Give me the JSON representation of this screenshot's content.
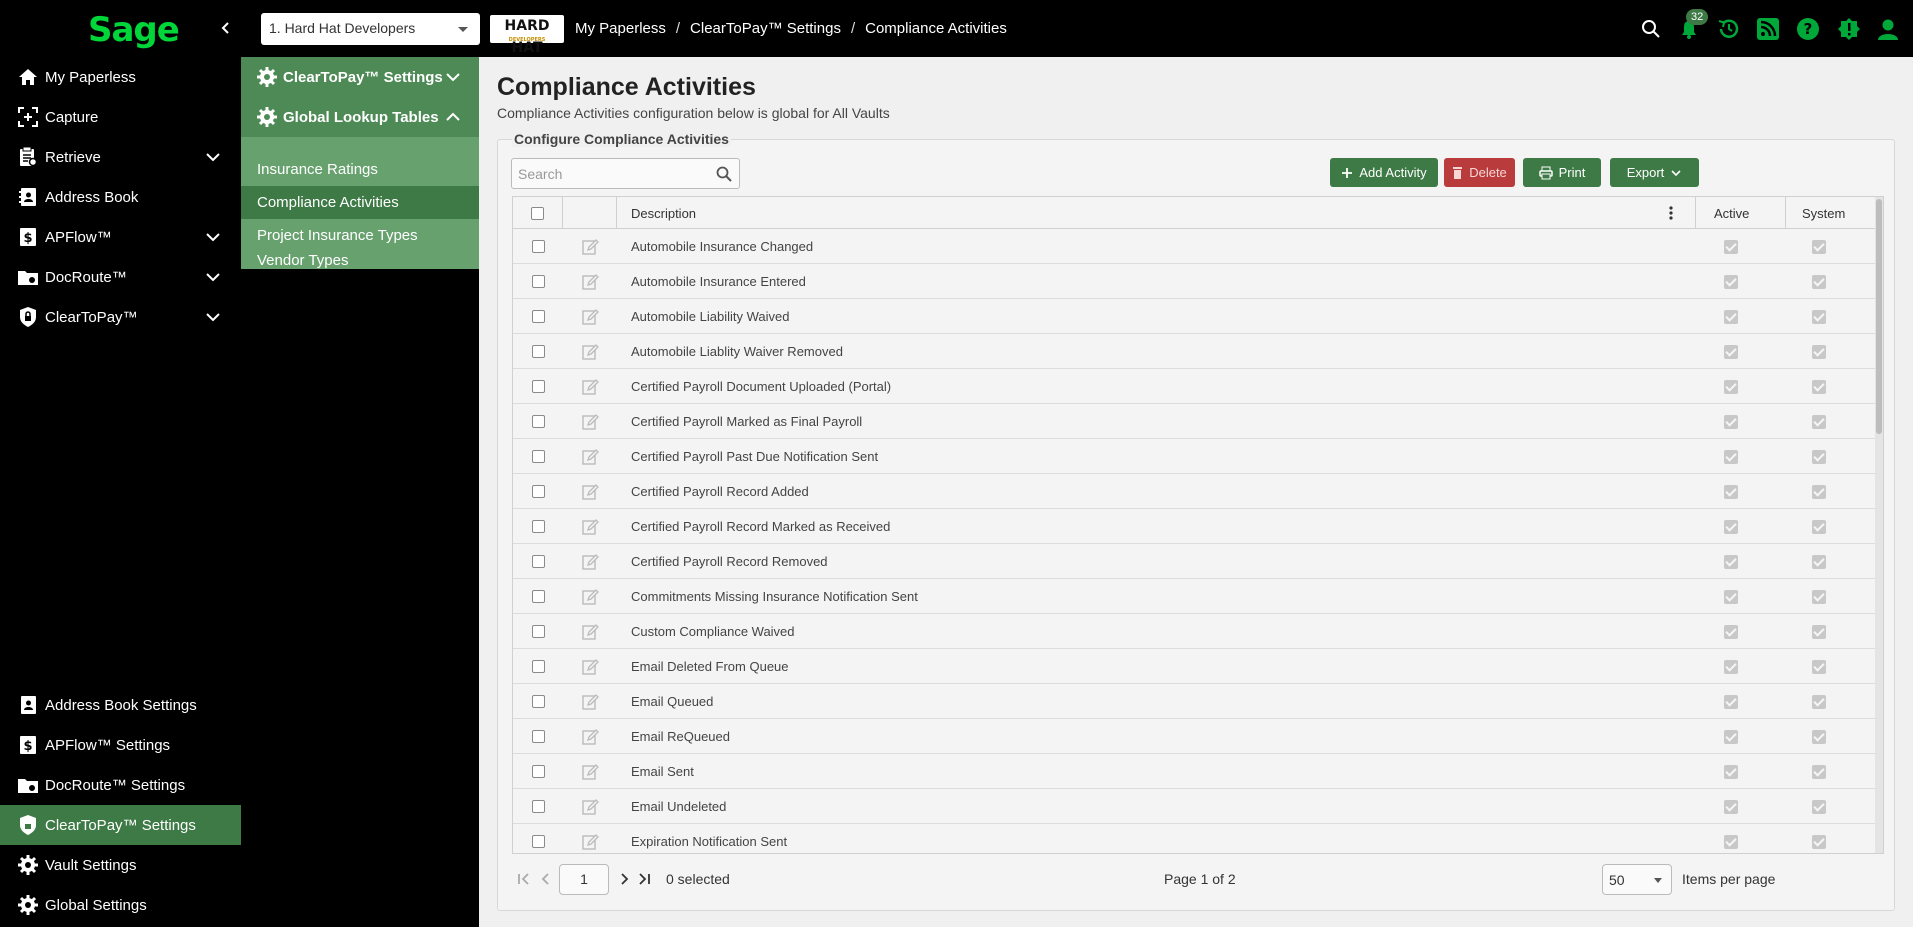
{
  "app": {
    "logo": "Sage",
    "collapse_glyph": "‹"
  },
  "topbar": {
    "vault_selected": "1. Hard Hat Developers",
    "company_logo_text": "HARD HAT",
    "company_logo_sub": "DEVELOPERS",
    "breadcrumb": [
      "My Paperless",
      "ClearToPay™ Settings",
      "Compliance Activities"
    ],
    "breadcrumb_sep": "/",
    "notification_count": "32",
    "icons": [
      "search-icon",
      "bell-icon",
      "history-icon",
      "rss-icon",
      "help-icon",
      "alert-icon",
      "user-icon"
    ],
    "accent_color": "#00a83a"
  },
  "leftnav": {
    "items": [
      {
        "label": "My Paperless",
        "icon": "home-icon"
      },
      {
        "label": "Capture",
        "icon": "capture-icon"
      },
      {
        "label": "Retrieve",
        "icon": "clipboard-icon",
        "expandable": true
      },
      {
        "label": "Address Book",
        "icon": "address-book-icon"
      },
      {
        "label": "APFlow™",
        "icon": "dollar-doc-icon",
        "expandable": true
      },
      {
        "label": "DocRoute™",
        "icon": "folder-route-icon",
        "expandable": true
      },
      {
        "label": "ClearToPay™",
        "icon": "shield-lock-icon",
        "expandable": true
      }
    ],
    "settings": [
      {
        "label": "Address Book Settings",
        "icon": "address-book-icon"
      },
      {
        "label": "APFlow™ Settings",
        "icon": "dollar-doc-icon"
      },
      {
        "label": "DocRoute™ Settings",
        "icon": "folder-route-icon"
      },
      {
        "label": "ClearToPay™ Settings",
        "icon": "shield-lock-icon",
        "active": true
      },
      {
        "label": "Vault Settings",
        "icon": "gear-icon"
      },
      {
        "label": "Global Settings",
        "icon": "gear-icon"
      }
    ]
  },
  "subnav": {
    "section1": "ClearToPay™ Settings",
    "section2": "Global Lookup Tables",
    "items": [
      {
        "label": "Insurance Ratings"
      },
      {
        "label": "Compliance Activities",
        "active": true
      },
      {
        "label": "Project Insurance Types"
      },
      {
        "label": "Vendor Types"
      }
    ]
  },
  "main": {
    "title": "Compliance Activities",
    "subtitle": "Compliance Activities configuration below is global for All Vaults",
    "panel_legend": "Configure Compliance Activities",
    "search_placeholder": "Search",
    "buttons": {
      "add": "Add Activity",
      "delete": "Delete",
      "print": "Print",
      "export": "Export"
    },
    "columns": {
      "description": "Description",
      "active": "Active",
      "system": "System"
    },
    "rows": [
      "Automobile Insurance Changed",
      "Automobile Insurance Entered",
      "Automobile Liability Waived",
      "Automobile Liablity Waiver Removed",
      "Certified Payroll Document Uploaded (Portal)",
      "Certified Payroll Marked as Final Payroll",
      "Certified Payroll Past Due Notification Sent",
      "Certified Payroll Record Added",
      "Certified Payroll Record Marked as Received",
      "Certified Payroll Record Removed",
      "Commitments Missing Insurance Notification Sent",
      "Custom Compliance Waived",
      "Email Deleted From Queue",
      "Email Queued",
      "Email ReQueued",
      "Email Sent",
      "Email Undeleted",
      "Expiration Notification Sent"
    ],
    "pager": {
      "page": "1",
      "selected": "0 selected",
      "info": "Page 1 of 2",
      "page_size": "50",
      "items_per_page": "Items per page"
    }
  }
}
